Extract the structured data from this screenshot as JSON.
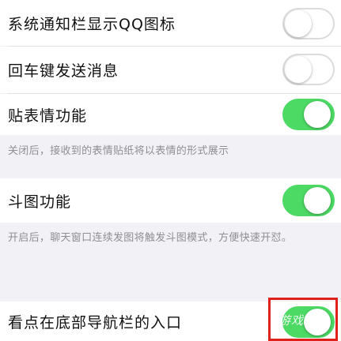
{
  "settings": {
    "tray_icon": {
      "label": "系统通知栏显示QQ图标",
      "enabled": false
    },
    "enter_send": {
      "label": "回车键发送消息",
      "enabled": false
    },
    "sticker": {
      "label": "贴表情功能",
      "enabled": true,
      "note": "关闭后，接收到的表情贴纸将以表情的形式展示"
    },
    "doutu": {
      "label": "斗图功能",
      "enabled": true,
      "note": "开启后，聊天窗口连续发图将触发斗图模式，方便快速开怼。"
    },
    "kandian": {
      "label": "看点在底部导航栏的入口",
      "enabled": true
    }
  },
  "watermark": "游戏",
  "colors": {
    "toggle_on": "#4cd964",
    "highlight": "#e0201a"
  }
}
